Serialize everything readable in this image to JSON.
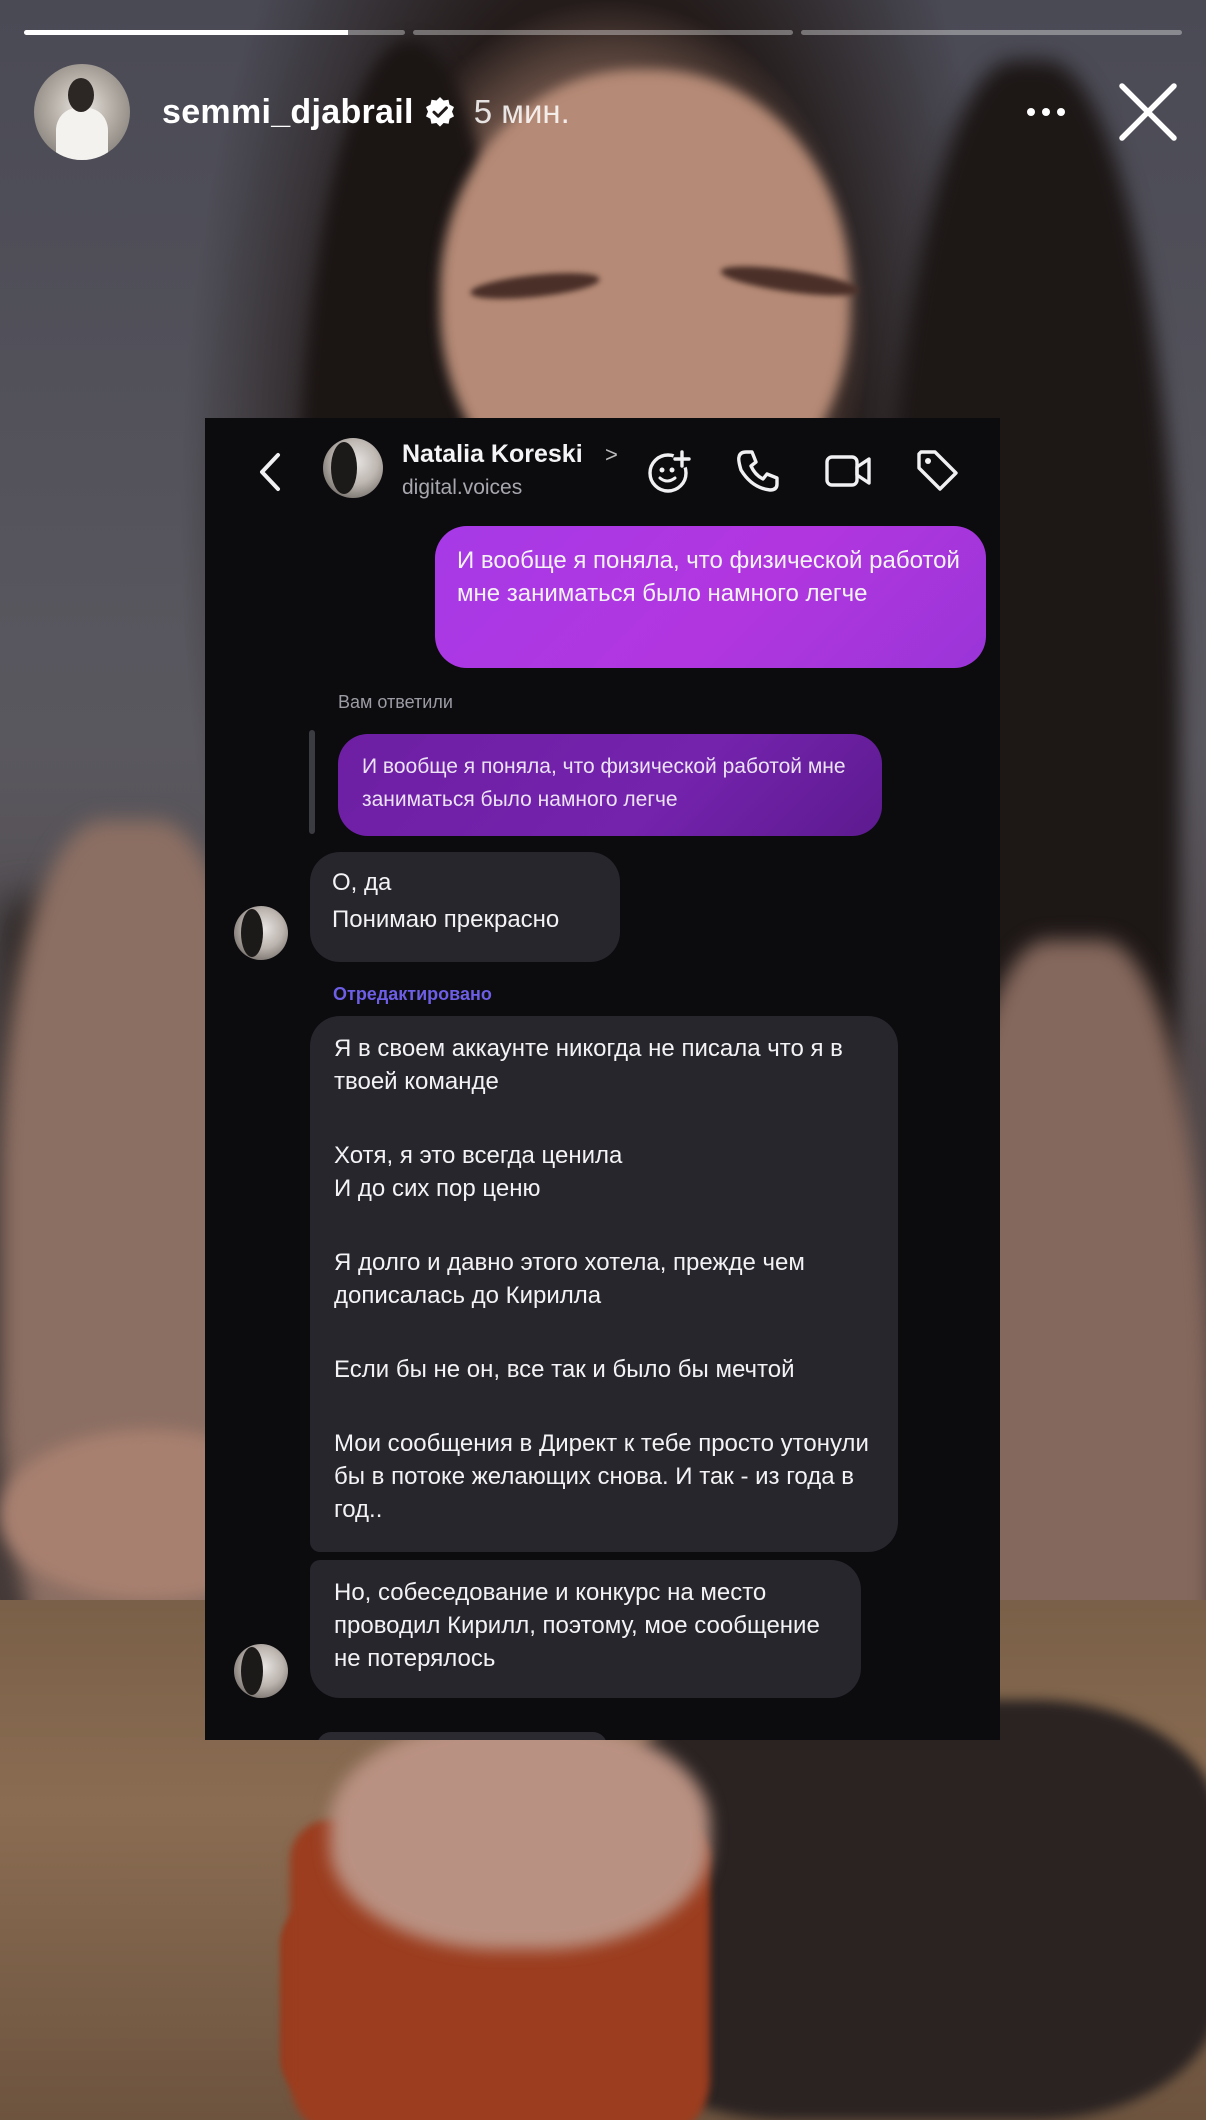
{
  "story": {
    "progress": [
      0.85,
      0.0,
      0.0
    ],
    "username": "semmi_djabrail",
    "verified": true,
    "time": "5 мин."
  },
  "dm": {
    "contact_name": "Natalia Koreski",
    "contact_handle": "digital.voices",
    "icons": [
      "back-icon",
      "sticker-icon",
      "phone-icon",
      "video-icon",
      "tag-icon"
    ],
    "messages": {
      "outgoing_1": "И вообще я поняла, что физической работой мне заниматься было намного легче",
      "replied_label": "Вам ответили",
      "quoted": "И вообще я поняла, что физической работой мне заниматься было намного легче",
      "incoming_1": [
        "О, да",
        "Понимаю прекрасно"
      ],
      "edited_label": "Отредактировано",
      "incoming_2": [
        "Я в своем аккаунте никогда не писала что я в твоей команде",
        "Хотя, я это всегда ценила\nИ до сих пор ценю",
        "Я долго и давно этого хотела, прежде чем дописалась до Кирилла",
        "Если бы не он, все так и было бы мечтой",
        "Мои сообщения в Директ к тебе просто утонули бы в потоке желающих снова. И так - из года в год.."
      ],
      "incoming_3": "Но, собеседование и конкурс на место проводил Кирилл, поэтому, мое сообщение не потерялось"
    }
  }
}
